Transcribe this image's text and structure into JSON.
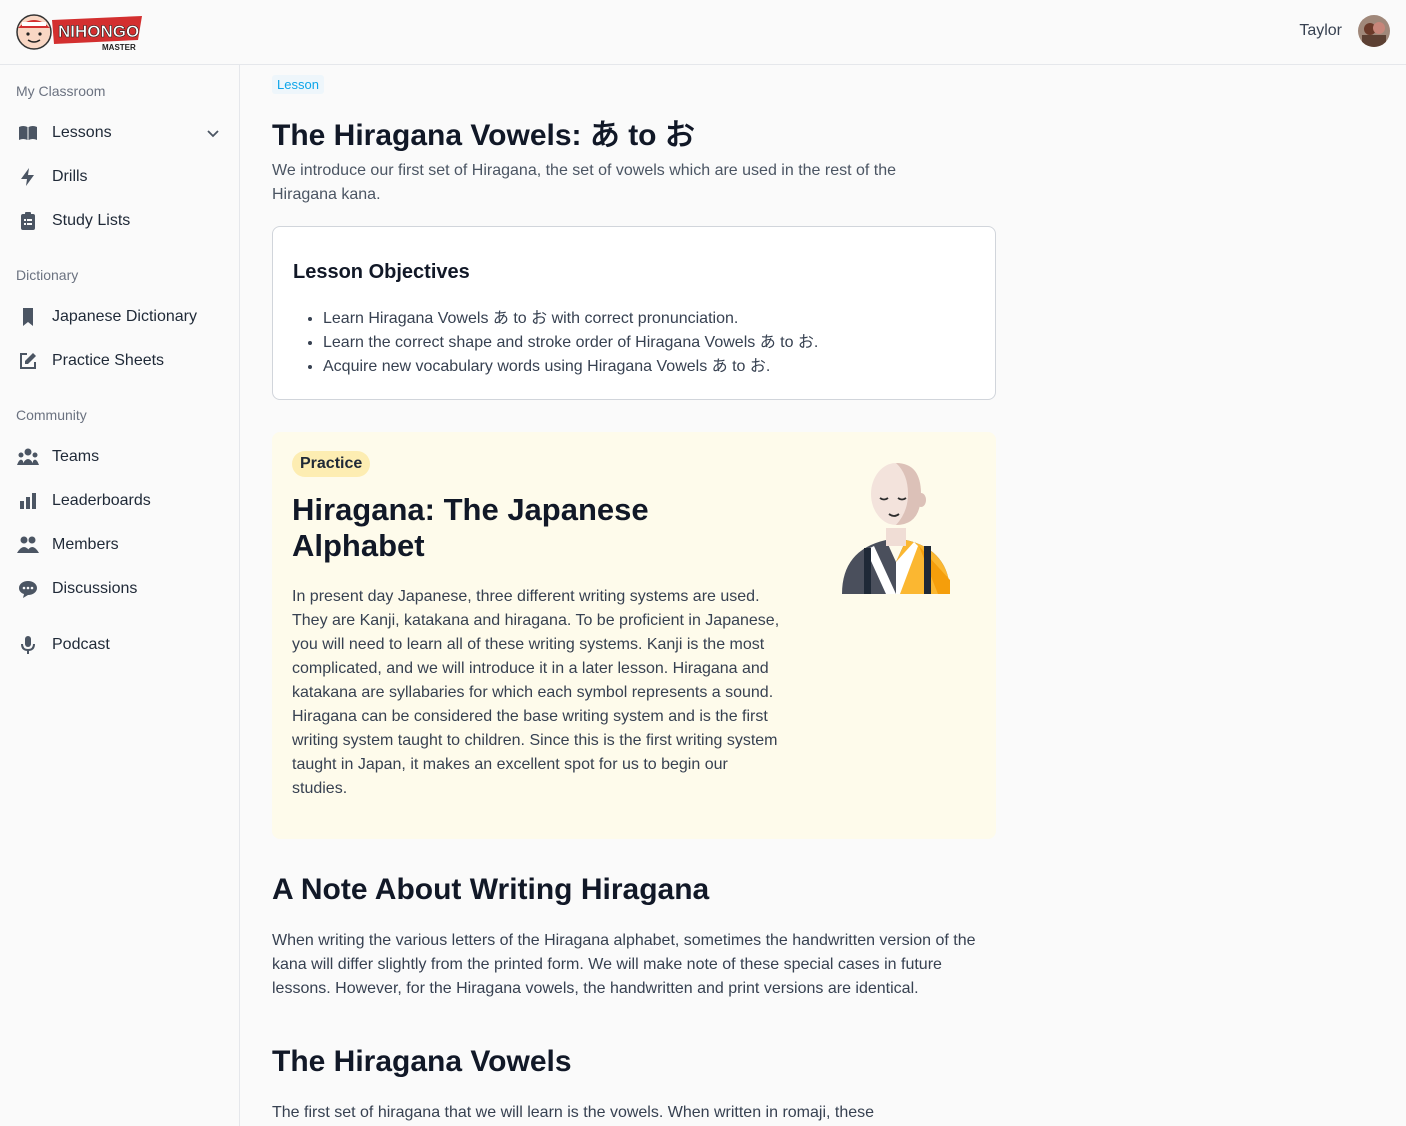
{
  "header": {
    "logo_text": "NIHONGO MASTER",
    "user_name": "Taylor"
  },
  "sidebar": {
    "sections": [
      {
        "label": "My Classroom"
      },
      {
        "label": "Dictionary"
      },
      {
        "label": "Community"
      }
    ],
    "items": [
      {
        "label": "Lessons",
        "icon": "book-open-icon"
      },
      {
        "label": "Drills",
        "icon": "lightning-icon"
      },
      {
        "label": "Study Lists",
        "icon": "clipboard-list-icon"
      },
      {
        "label": "Japanese Dictionary",
        "icon": "bookmark-icon"
      },
      {
        "label": "Practice Sheets",
        "icon": "pencil-square-icon"
      },
      {
        "label": "Teams",
        "icon": "user-group-icon"
      },
      {
        "label": "Leaderboards",
        "icon": "chart-bar-icon"
      },
      {
        "label": "Members",
        "icon": "users-icon"
      },
      {
        "label": "Discussions",
        "icon": "chat-icon"
      },
      {
        "label": "Podcast",
        "icon": "microphone-icon"
      }
    ]
  },
  "lesson": {
    "badge": "Lesson",
    "title": "The Hiragana Vowels: あ to お",
    "description": "We introduce our first set of Hiragana, the set of vowels which are used in the rest of the Hiragana kana.",
    "objectives_title": "Lesson Objectives",
    "objectives": [
      "Learn Hiragana Vowels あ to お with correct pronunciation.",
      "Learn the correct shape and stroke order of Hiragana Vowels あ to お.",
      "Acquire new vocabulary words using Hiragana Vowels あ to お."
    ]
  },
  "practice": {
    "badge": "Practice",
    "title": "Hiragana: The Japanese Alphabet",
    "body": "In present day Japanese, three different writing systems are used. They are Kanji, katakana and hiragana. To be proficient in Japanese, you will need to learn all of these writing systems. Kanji is the most complicated, and we will introduce it in a later lesson. Hiragana and katakana are syllabaries for which each symbol represents a sound. Hiragana can be considered the base writing system and is the first writing system taught to children. Since this is the first writing system taught in Japan, it makes an excellent spot for us to begin our studies."
  },
  "sections": [
    {
      "heading": "A Note About Writing Hiragana",
      "body": "When writing the various letters of the Hiragana alphabet, sometimes the handwritten version of the kana will differ slightly from the printed form. We will make note of these special cases in future lessons. However, for the Hiragana vowels, the handwritten and print versions are identical."
    },
    {
      "heading": "The Hiragana Vowels",
      "body": "The first set of hiragana that we will learn is the vowels. When written in romaji, these"
    }
  ]
}
